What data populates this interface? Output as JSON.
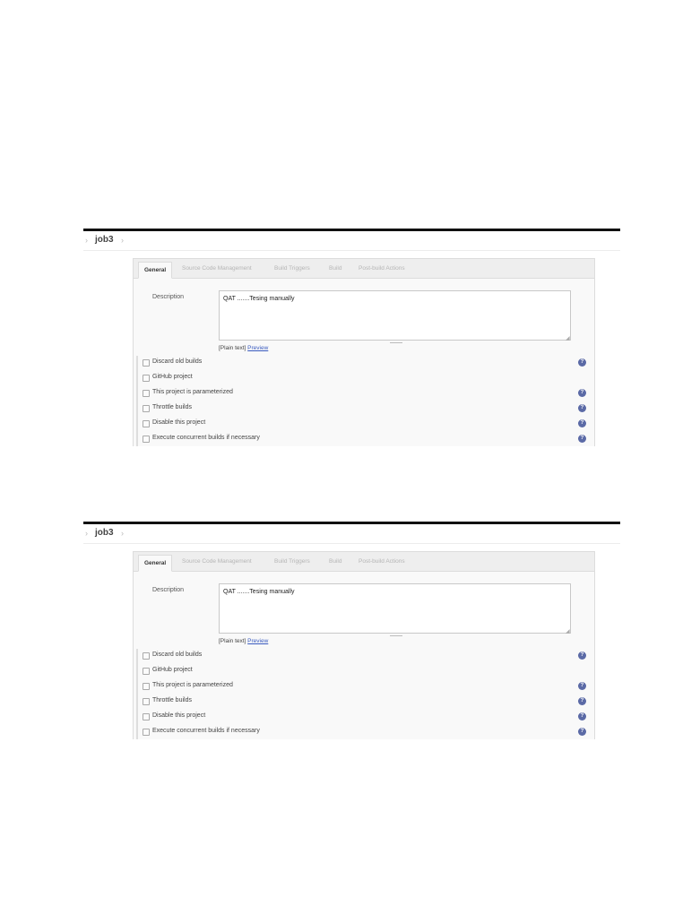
{
  "screens": [
    {
      "breadcrumb": {
        "sep_left": "›",
        "job": "job3",
        "sep_right": "›"
      },
      "tabs": [
        "General",
        "Source Code Management",
        "Build Triggers",
        "Build",
        "Post-build Actions"
      ],
      "description": {
        "label": "Description",
        "value": "QAT .......Tesing manually"
      },
      "format": {
        "plain": "[Plain text]",
        "preview": "Preview"
      },
      "options": [
        {
          "label": "Discard old builds",
          "help": "?"
        },
        {
          "label": "GitHub project",
          "help": ""
        },
        {
          "label": "This project is parameterized",
          "help": "?"
        },
        {
          "label": "Throttle builds",
          "help": "?"
        },
        {
          "label": "Disable this project",
          "help": "?"
        },
        {
          "label": "Execute concurrent builds if necessary",
          "help": "?"
        }
      ]
    },
    {
      "breadcrumb": {
        "sep_left": "›",
        "job": "job3",
        "sep_right": "›"
      },
      "tabs": [
        "General",
        "Source Code Management",
        "Build Triggers",
        "Build",
        "Post-build Actions"
      ],
      "description": {
        "label": "Description",
        "value": "QAT .......Tesing manually"
      },
      "format": {
        "plain": "[Plain text]",
        "preview": "Preview"
      },
      "options": [
        {
          "label": "Discard old builds",
          "help": "?"
        },
        {
          "label": "GitHub project",
          "help": ""
        },
        {
          "label": "This project is parameterized",
          "help": "?"
        },
        {
          "label": "Throttle builds",
          "help": "?"
        },
        {
          "label": "Disable this project",
          "help": "?"
        },
        {
          "label": "Execute concurrent builds if necessary",
          "help": "?"
        }
      ]
    }
  ]
}
